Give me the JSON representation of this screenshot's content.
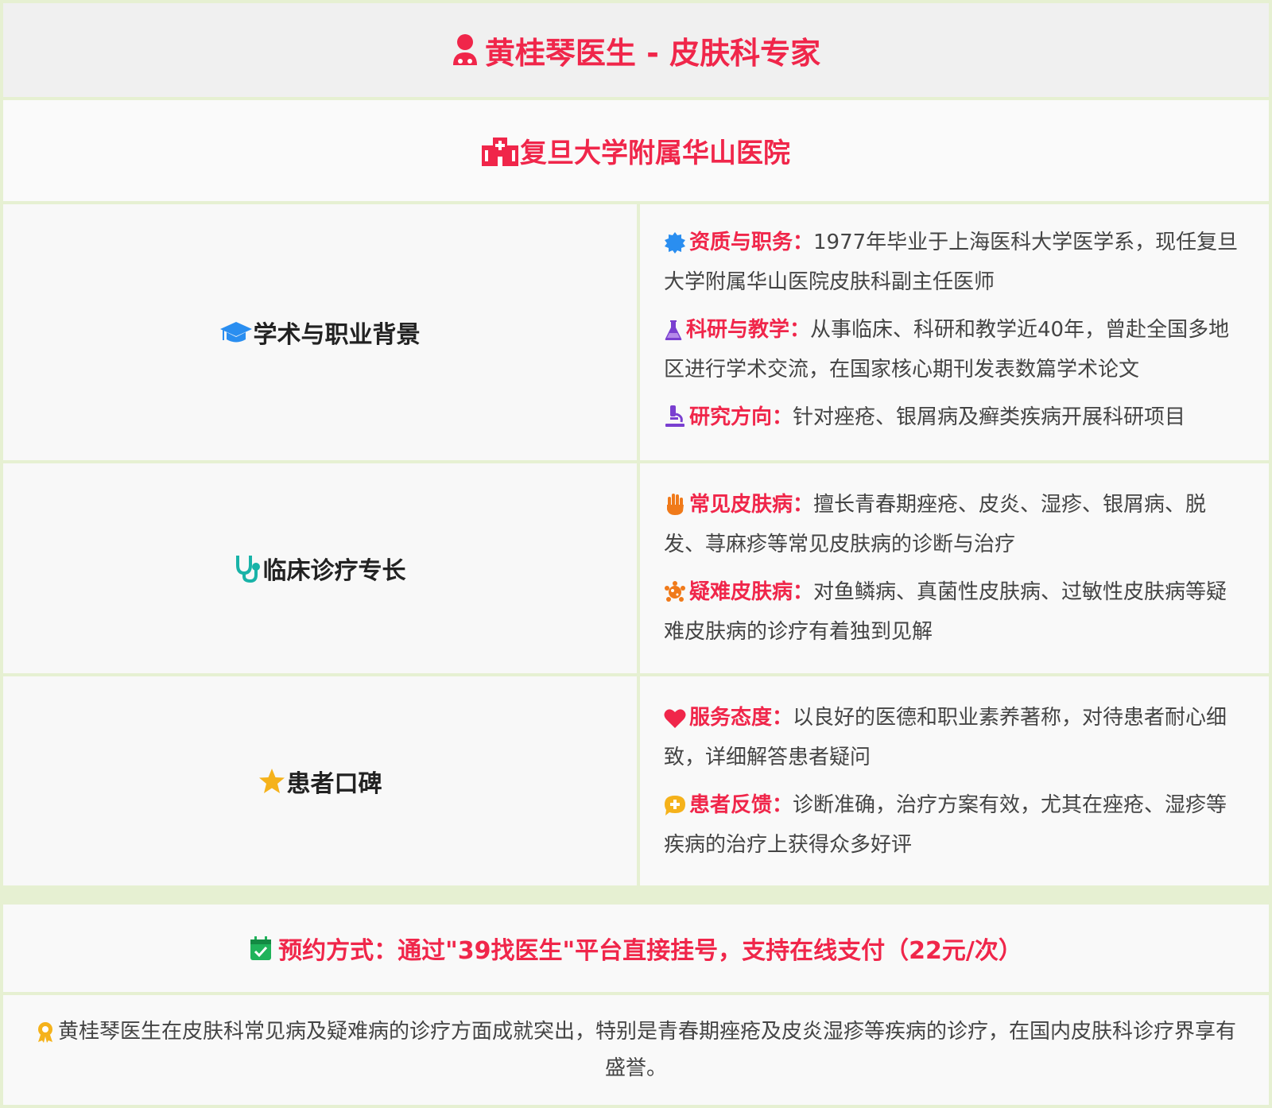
{
  "header": {
    "title": "黄桂琴医生 - 皮肤科专家"
  },
  "hospital": {
    "name": "复旦大学附属华山医院"
  },
  "sections": [
    {
      "title": "学术与职业背景",
      "items": [
        {
          "label": "资质与职务：",
          "text": "1977年毕业于上海医科大学医学系，现任复旦大学附属华山医院皮肤科副主任医师"
        },
        {
          "label": "科研与教学：",
          "text": "从事临床、科研和教学近40年，曾赴全国多地区进行学术交流，在国家核心期刊发表数篇学术论文"
        },
        {
          "label": "研究方向：",
          "text": "针对痤疮、银屑病及癣类疾病开展科研项目"
        }
      ]
    },
    {
      "title": "临床诊疗专长",
      "items": [
        {
          "label": "常见皮肤病：",
          "text": "擅长青春期痤疮、皮炎、湿疹、银屑病、脱发、荨麻疹等常见皮肤病的诊断与治疗"
        },
        {
          "label": "疑难皮肤病：",
          "text": "对鱼鳞病、真菌性皮肤病、过敏性皮肤病等疑难皮肤病的诊疗有着独到见解"
        }
      ]
    },
    {
      "title": "患者口碑",
      "items": [
        {
          "label": "服务态度：",
          "text": "以良好的医德和职业素养著称，对待患者耐心细致，详细解答患者疑问"
        },
        {
          "label": "患者反馈：",
          "text": "诊断准确，治疗方案有效，尤其在痤疮、湿疹等疾病的治疗上获得众多好评"
        }
      ]
    }
  ],
  "appointment": {
    "text": "预约方式：通过\"39找医生\"平台直接挂号，支持在线支付（22元/次）"
  },
  "summary": {
    "text": "黄桂琴医生在皮肤科常见病及疑难病的诊疗方面成就突出，特别是青春期痤疮及皮炎湿疹等疾病的诊疗，在国内皮肤科诊疗界享有盛誉。"
  },
  "colors": {
    "accent": "#f0264a",
    "border": "#e6f0d2"
  }
}
